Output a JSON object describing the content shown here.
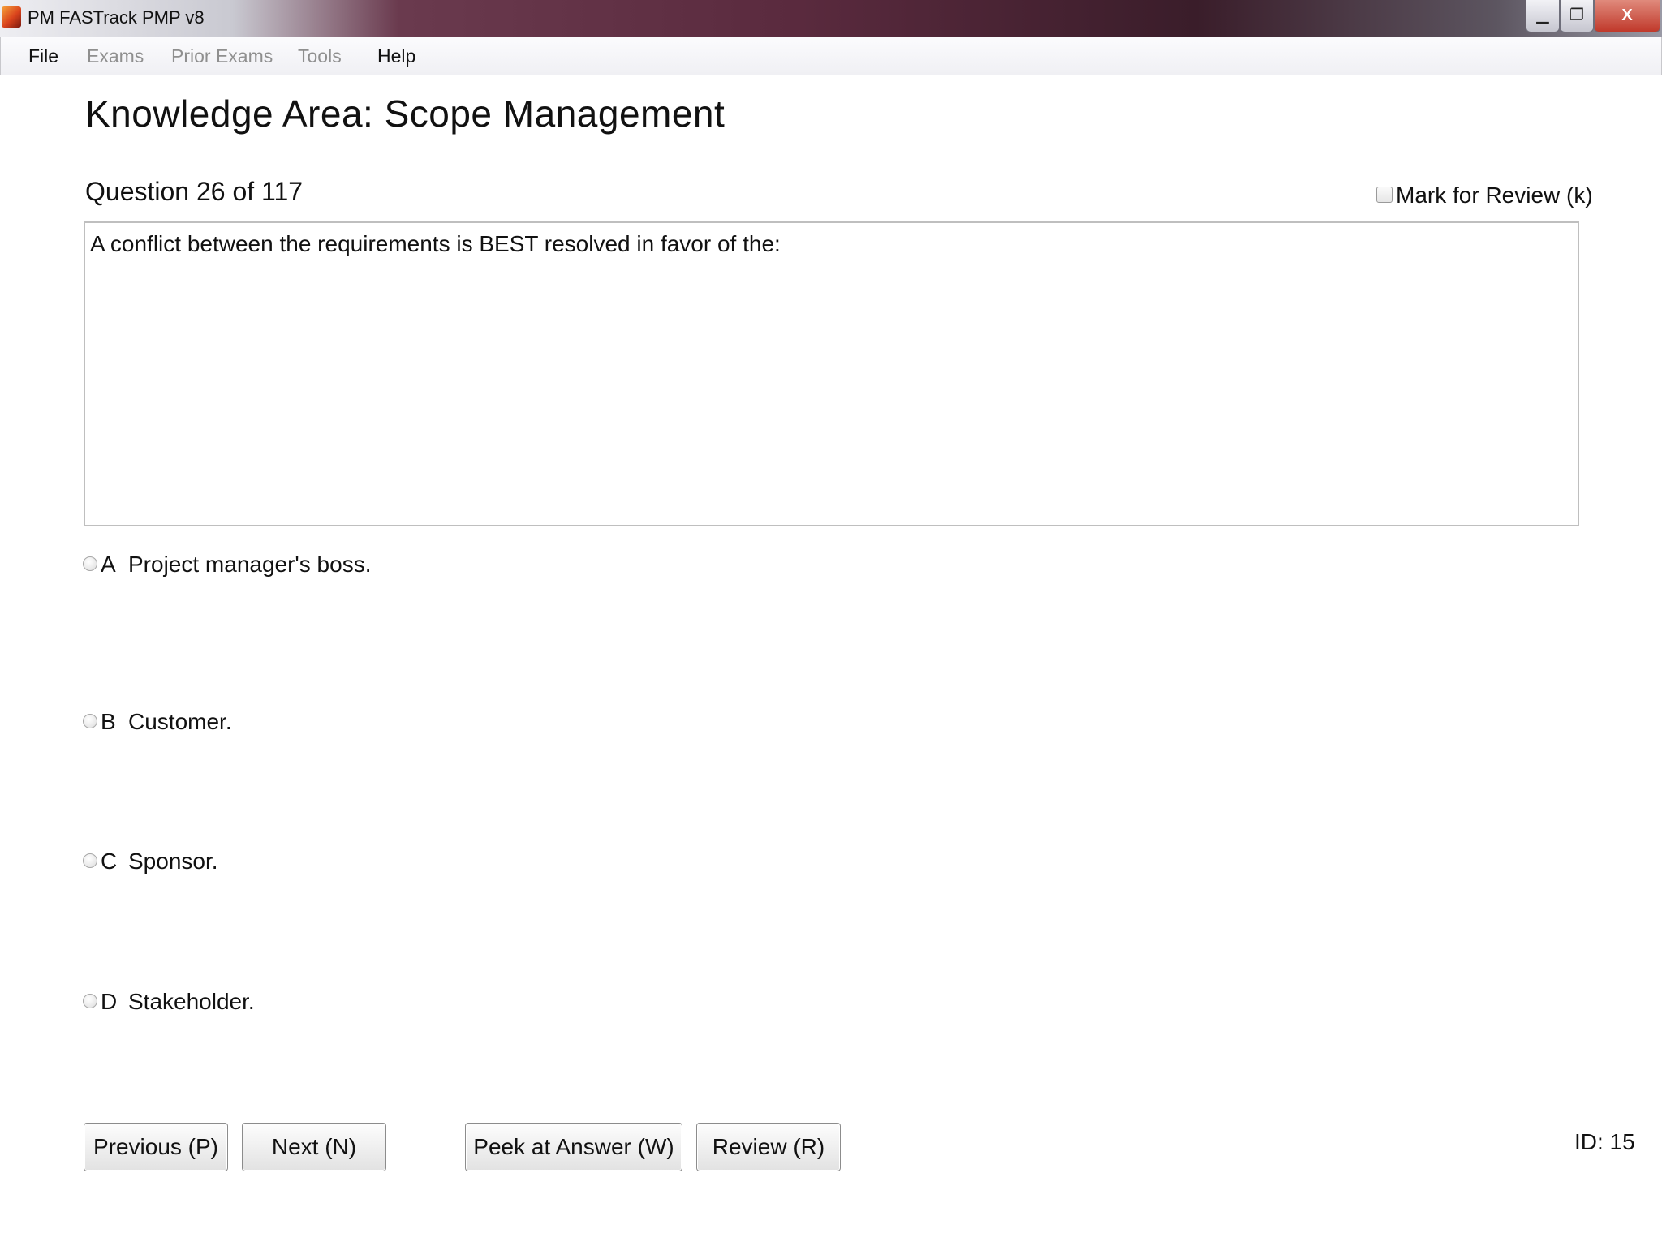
{
  "window": {
    "title": "PM FASTrack PMP v8",
    "min_glyph": "▁",
    "max_glyph": "❐",
    "close_glyph": "X"
  },
  "menu": {
    "items": [
      {
        "label": "File",
        "enabled": true
      },
      {
        "label": "Exams",
        "enabled": false
      },
      {
        "label": "Prior Exams",
        "enabled": false
      },
      {
        "label": "Tools",
        "enabled": false
      },
      {
        "label": "Help",
        "enabled": true
      }
    ]
  },
  "page": {
    "title": "Knowledge Area: Scope Management",
    "question_counter": "Question 26 of 117",
    "mark_for_review": "Mark for Review (k)",
    "question_text": "A conflict between the requirements is BEST resolved in favor of the:"
  },
  "options": [
    {
      "letter": "A",
      "text": "Project manager's boss."
    },
    {
      "letter": "B",
      "text": "Customer."
    },
    {
      "letter": "C",
      "text": "Sponsor."
    },
    {
      "letter": "D",
      "text": "Stakeholder."
    }
  ],
  "buttons": {
    "previous": "Previous (P)",
    "next": "Next (N)",
    "peek": "Peek at Answer (W)",
    "review": "Review (R)"
  },
  "id_label": "ID: 15"
}
